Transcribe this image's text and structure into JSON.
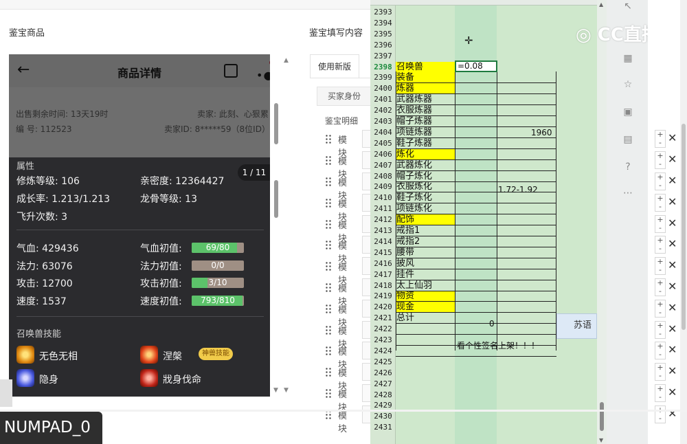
{
  "headers": {
    "left": "鉴宝商品",
    "middle": "鉴宝填写内容"
  },
  "phone": {
    "title": "商品详情",
    "meta": {
      "time_left": "出售剩余时间: 13天19时",
      "seller": "卖家: 此刻、心狠累",
      "serial": "编 号: 112523",
      "seller_id": "卖家ID: 8*****59（8位ID）"
    },
    "attributes_label": "属性",
    "page_badge": "1 / 11",
    "stats": {
      "cultivation": "修炼等级: 106",
      "intimacy": "亲密度: 12364427",
      "growth": "成长率: 1.213/1.213",
      "dragon_bone": "龙骨等级: 13",
      "ascend": "飞升次数: 3",
      "hp": "气血: 429436",
      "hp_init_label": "气血初值:",
      "mp": "法力: 63076",
      "mp_init_label": "法力初值:",
      "atk": "攻击: 12700",
      "atk_init_label": "攻击初值:",
      "spd": "速度: 1537",
      "spd_init_label": "速度初值:"
    },
    "bars": [
      {
        "text": "69/80",
        "fill": 0.8625
      },
      {
        "text": "0/0",
        "fill": 0
      },
      {
        "text": "3/10",
        "fill": 0.3
      },
      {
        "text": "793/810",
        "fill": 0.979
      }
    ],
    "skills_label": "召唤兽技能",
    "skills": [
      "无色无相",
      "涅槃",
      "隐身",
      "戕身伐命"
    ],
    "skill_badge": "神兽技能"
  },
  "form": {
    "tab_new": "使用新版",
    "buyer_tab": "买家身份",
    "detail_label": "鉴宝明细",
    "module_label": "模块"
  },
  "sheet": {
    "rows": [
      "2393",
      "2394",
      "2395",
      "2396",
      "2397",
      "2398",
      "2399",
      "2400",
      "2401",
      "2402",
      "2403",
      "2404",
      "2405",
      "2406",
      "2407",
      "2408",
      "2409",
      "2410",
      "2411",
      "2412",
      "2413",
      "2414",
      "2415",
      "2416",
      "2417",
      "2418",
      "2419",
      "2420",
      "2421",
      "2422",
      "2423",
      "2424",
      "2425",
      "2426",
      "2427",
      "2428",
      "2429",
      "2430",
      "2431"
    ],
    "active_row": "2398",
    "col_a": [
      "",
      "",
      "",
      "",
      "",
      "召唤兽",
      "装备",
      "炼器",
      "武器炼器",
      "衣服炼器",
      "帽子炼器",
      "项链炼器",
      "鞋子炼器",
      "炼化",
      "武器炼化",
      "帽子炼化",
      "衣服炼化",
      "鞋子炼化",
      "项链炼化",
      "配饰",
      "戒指1",
      "戒指2",
      "腰带",
      "披风",
      "挂件",
      "太上仙羽",
      "物资",
      "现金",
      "总计",
      "",
      "",
      "",
      "",
      "",
      "",
      "",
      "",
      "",
      ""
    ],
    "highlighted": [
      "召唤兽",
      "装备",
      "炼器",
      "炼化",
      "配饰",
      "物资",
      "现金"
    ],
    "b2398": "=0.08",
    "c2404": "1960",
    "c2409": "1.72-1.92",
    "b2421": "0",
    "b2423": "看个性签名上架！！！",
    "side_box": "苏语"
  },
  "watermark": "CC直播",
  "key_overlay": "NUMPAD_0",
  "colors": {
    "sheet_bg": "#cfe8cc",
    "yellow": "#ffff00",
    "bar_green": "#5cc26a",
    "dark_panel": "#2b2b2e"
  }
}
